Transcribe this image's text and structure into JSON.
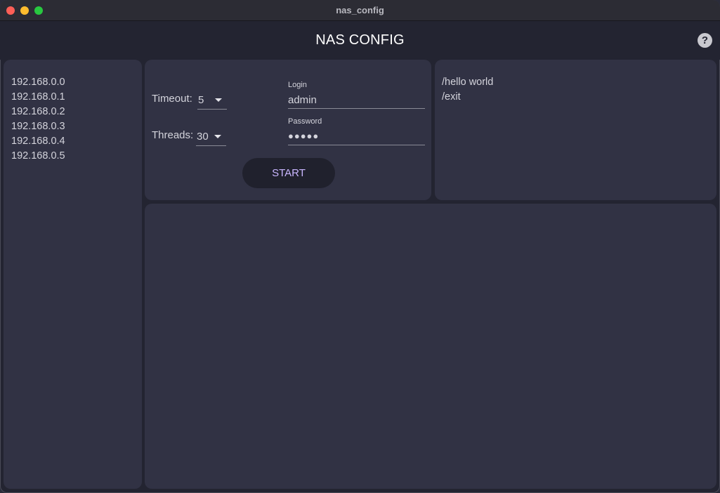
{
  "window": {
    "title": "nas_config"
  },
  "app": {
    "title": "NAS CONFIG",
    "help_label": "?"
  },
  "hosts": [
    "192.168.0.0",
    "192.168.0.1",
    "192.168.0.2",
    "192.168.0.3",
    "192.168.0.4",
    "192.168.0.5"
  ],
  "settings": {
    "timeout_label": "Timeout:",
    "timeout_value": "5",
    "threads_label": "Threads:",
    "threads_value": "30",
    "login_label": "Login",
    "login_value": "admin",
    "password_label": "Password",
    "password_value": "●●●●●",
    "start_label": "START"
  },
  "commands": [
    "/hello world",
    "/exit"
  ],
  "colors": {
    "background": "#232431",
    "panel": "#313244",
    "accent": "#c9b6ff"
  },
  "icons": {
    "help": "question-circle-icon",
    "dropdown": "caret-down-icon"
  }
}
